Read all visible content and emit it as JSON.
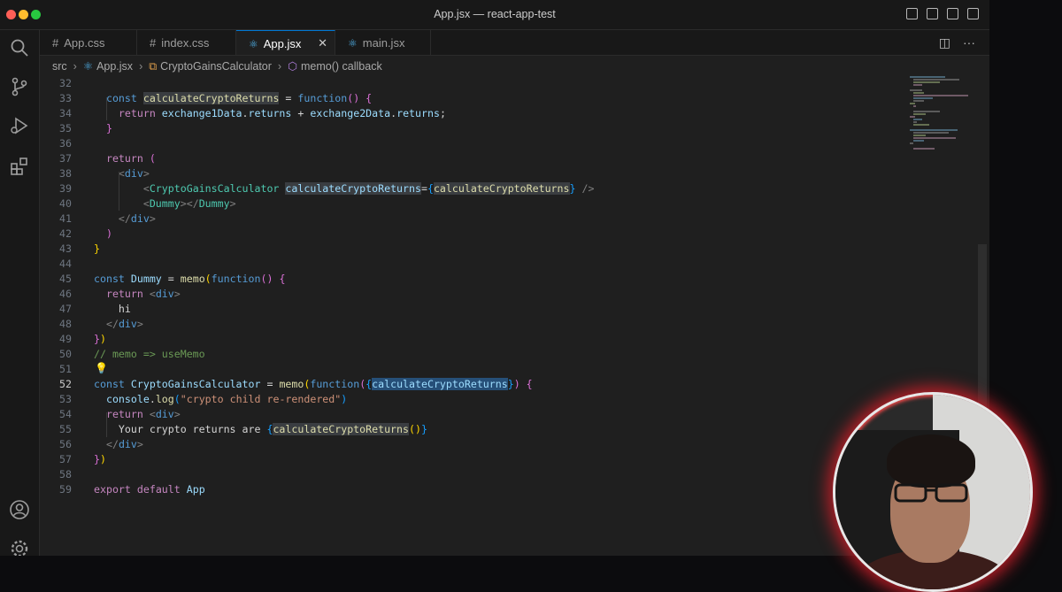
{
  "window": {
    "title": "App.jsx — react-app-test"
  },
  "tabs": [
    {
      "label": "App.css",
      "type": "css",
      "active": false
    },
    {
      "label": "index.css",
      "type": "css",
      "active": false
    },
    {
      "label": "App.jsx",
      "type": "react",
      "active": true
    },
    {
      "label": "main.jsx",
      "type": "react",
      "active": false
    }
  ],
  "tab_close_glyph": "✕",
  "breadcrumb": [
    "src",
    "App.jsx",
    "CryptoGainsCalculator",
    "memo() callback"
  ],
  "editor": {
    "current_line": 52,
    "line_numbers": [
      "32",
      "33",
      "34",
      "35",
      "36",
      "37",
      "38",
      "39",
      "40",
      "41",
      "42",
      "43",
      "44",
      "45",
      "46",
      "47",
      "48",
      "49",
      "50",
      "51",
      "52",
      "53",
      "54",
      "55",
      "56",
      "57",
      "58",
      "59"
    ]
  },
  "activity_icons": [
    "explorer-icon",
    "source-control-icon",
    "run-debug-icon",
    "extensions-icon",
    "account-icon",
    "settings-icon"
  ],
  "colors": {
    "accent": "#0078d4",
    "editor_bg": "#1f1f1f",
    "webcam_ring": "#e02030"
  }
}
